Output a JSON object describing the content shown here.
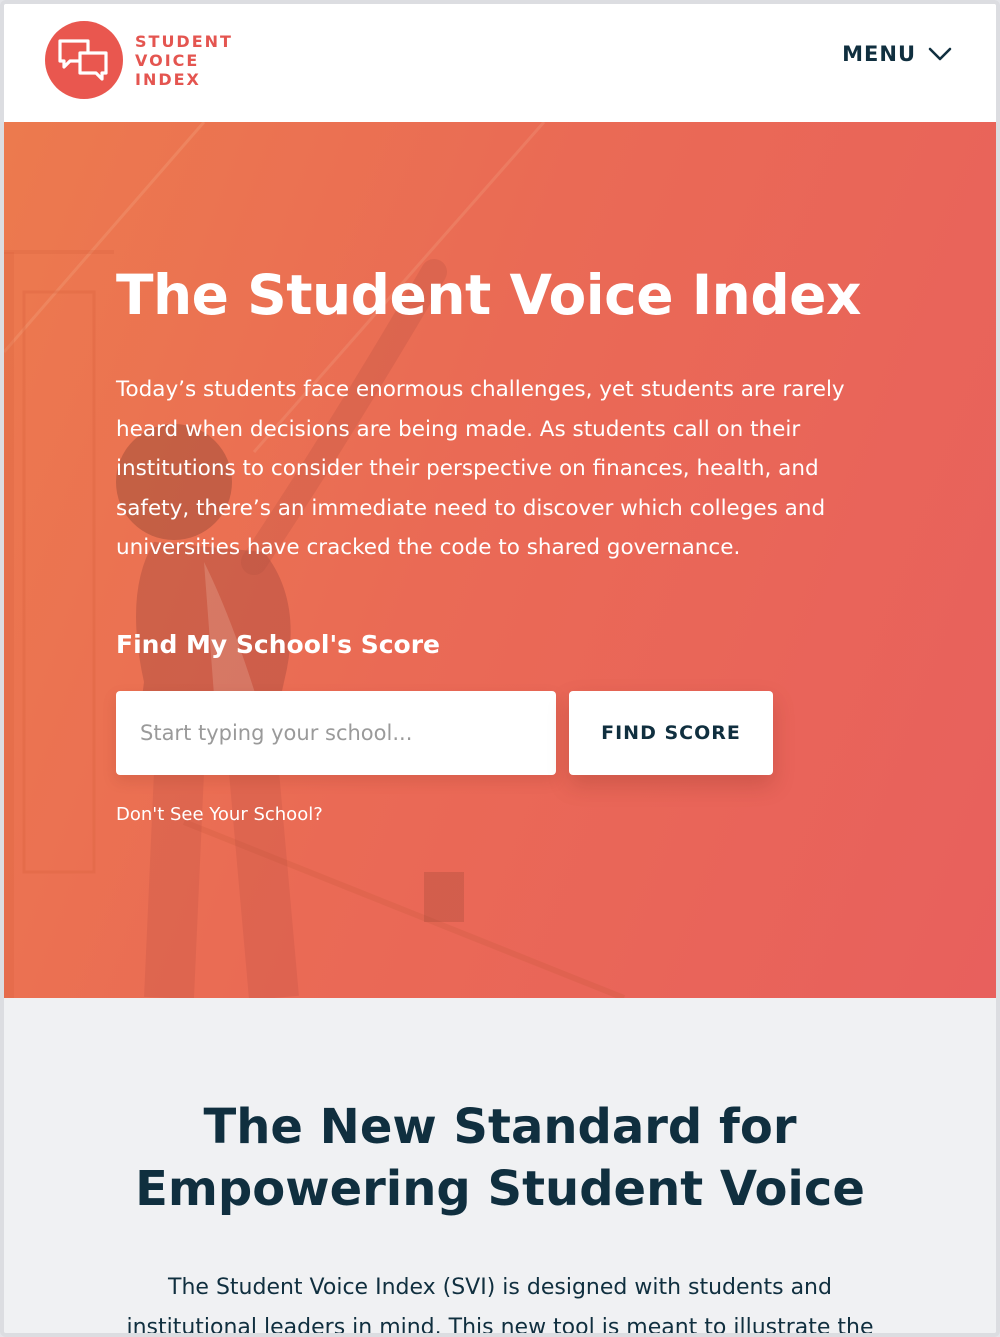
{
  "brand": {
    "logo_line1": "STUDENT",
    "logo_line2": "VOICE",
    "logo_line3": "INDEX",
    "color": "#e9574f"
  },
  "nav": {
    "menu_label": "MENU",
    "menu_icon": "chevron-down-icon"
  },
  "hero": {
    "title": "The Student Voice Index",
    "description": "Today’s students face enormous challenges, yet students are rarely heard when decisions are being made. As students call on their institutions to consider their perspective on finances, health, and safety, there’s an immediate need to discover which colleges and universities have cracked the code to shared governance.",
    "find_label": "Find My School's Score",
    "search_placeholder": "Start typing your school...",
    "search_value": "",
    "find_button": "FIND SCORE",
    "dont_see_link": "Don't See Your School?",
    "gradient_colors": [
      "#ec7a4e",
      "#e8605d"
    ]
  },
  "standard": {
    "title_line1": "The New Standard for",
    "title_line2": "Empowering Student Voice",
    "text": "The Student Voice Index (SVI) is designed with students and institutional leaders in mind. This new tool is meant to illustrate the"
  },
  "colors": {
    "navy": "#102f3f",
    "section_bg": "#f0f1f3"
  }
}
